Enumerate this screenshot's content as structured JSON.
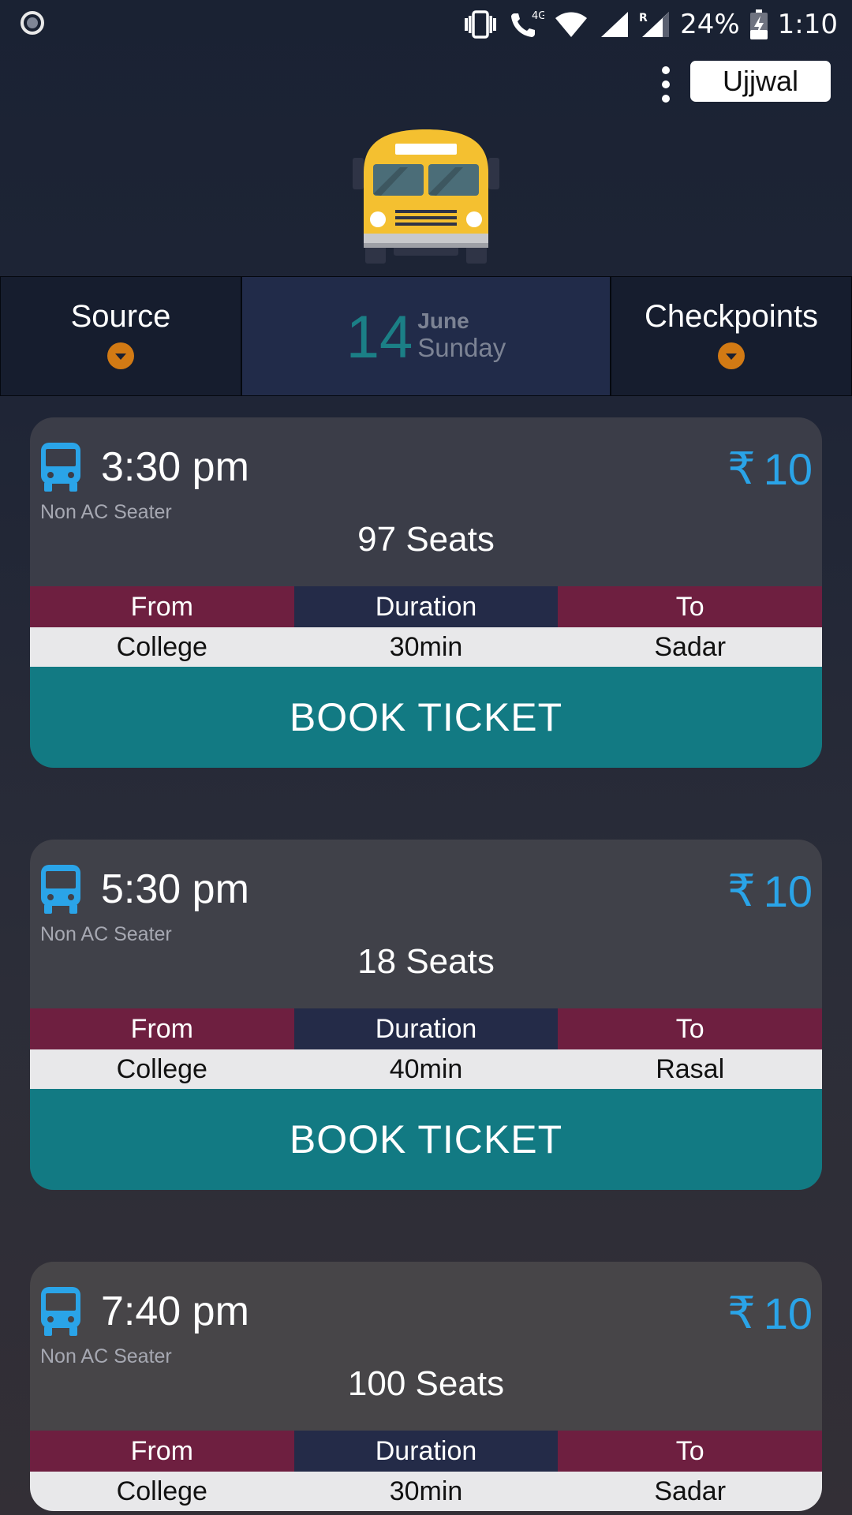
{
  "status_bar": {
    "network_label": "4G",
    "roaming_label": "R",
    "battery": "24%",
    "time": "1:10"
  },
  "app_bar": {
    "user_name": "Ujjwal"
  },
  "selector": {
    "source_label": "Source",
    "date_day": "14",
    "date_month": "June",
    "date_weekday": "Sunday",
    "checkpoints_label": "Checkpoints"
  },
  "labels": {
    "from": "From",
    "duration": "Duration",
    "to": "To",
    "book": "BOOK TICKET",
    "currency_symbol": "₹"
  },
  "trips": [
    {
      "time": "3:30 pm",
      "type": "Non AC Seater",
      "price": "10",
      "seats": "97 Seats",
      "from": "College",
      "duration": "30min",
      "to": "Sadar"
    },
    {
      "time": "5:30 pm",
      "type": "Non AC Seater",
      "price": "10",
      "seats": "18 Seats",
      "from": "College",
      "duration": "40min",
      "to": "Rasal"
    },
    {
      "time": "7:40 pm",
      "type": "Non AC Seater",
      "price": "10",
      "seats": "100 Seats",
      "from": "College",
      "duration": "30min",
      "to": "Sadar"
    }
  ],
  "colors": {
    "accent_teal": "#127a83",
    "price_blue": "#2aa4e8",
    "route_maroon": "#6e1f40",
    "route_navy": "#242b48",
    "dropdown_orange": "#d27a14"
  },
  "icons": {
    "status_record": "screen-record-icon",
    "vibrate": "vibrate-icon",
    "call": "call-icon",
    "wifi": "wifi-icon",
    "signal": "signal-icon",
    "battery": "battery-charging-icon",
    "menu": "overflow-menu-icon",
    "bus": "bus-icon",
    "dropdown": "dropdown-icon"
  }
}
